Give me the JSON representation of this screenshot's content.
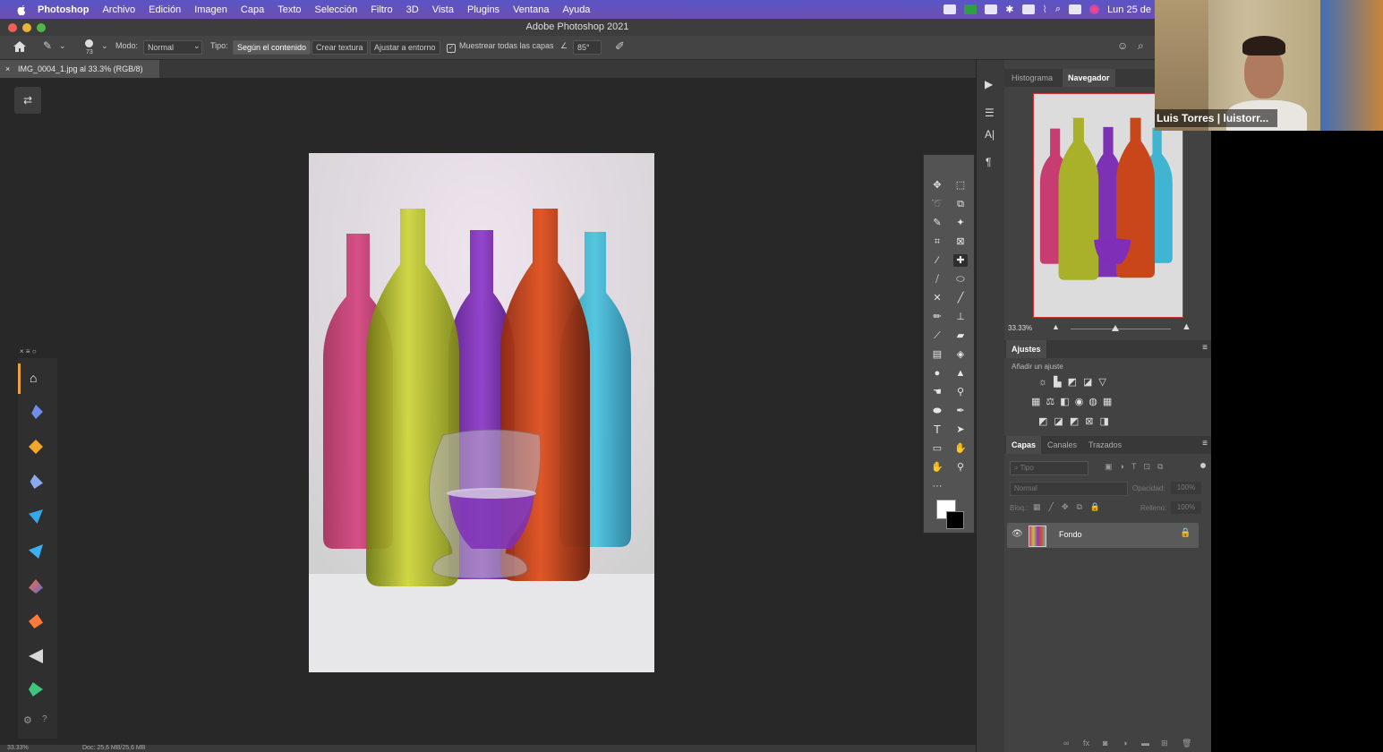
{
  "menubar": {
    "app": "Photoshop",
    "items": [
      "Archivo",
      "Edición",
      "Imagen",
      "Capa",
      "Texto",
      "Selección",
      "Filtro",
      "3D",
      "Vista",
      "Plugins",
      "Ventana",
      "Ayuda"
    ],
    "clock": "Lun 25 de"
  },
  "window": {
    "title": "Adobe Photoshop 2021"
  },
  "options": {
    "brush_size": "73",
    "mode_label": "Modo:",
    "mode_value": "Normal",
    "type_label": "Tipo:",
    "type_options": [
      "Según el contenido",
      "Crear textura",
      "Ajustar a entorno"
    ],
    "sample_all": "Muestrear todas las capas",
    "angle": "85°"
  },
  "document": {
    "tab_title": "IMG_0004_1.jpg al 33.3% (RGB/8)"
  },
  "navigator": {
    "tabs": [
      "Histograma",
      "Navegador"
    ],
    "active_tab": "Navegador",
    "zoom": "33.33%",
    "zoom_slider_fraction": 0.45
  },
  "adjustments": {
    "title": "Ajustes",
    "subtitle": "Añadir un ajuste"
  },
  "layers": {
    "tabs": [
      "Capas",
      "Canales",
      "Trazados"
    ],
    "search_placeholder": "Tipo",
    "blend_mode": "Normal",
    "opacity_label": "Opacidad:",
    "opacity_value": "100%",
    "lock_label": "Bloq.:",
    "fill_label": "Relleno:",
    "fill_value": "100%",
    "items": [
      {
        "name": "Fondo"
      }
    ]
  },
  "status": {
    "zoom": "33.33%",
    "doc": "Doc: 25,6 MB/25,6 MB"
  },
  "webcam": {
    "name": "Luis Torres | luistorr..."
  },
  "colors": {
    "menubar": "#5a55c6",
    "canvas_bg": "#282828",
    "panel_bg": "#424242"
  }
}
